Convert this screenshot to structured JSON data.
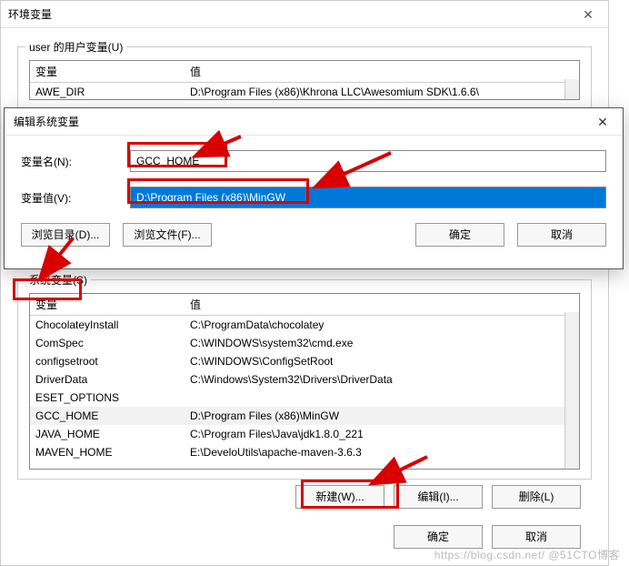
{
  "env": {
    "title": "环境变量",
    "user_group_label": "user 的用户变量(U)",
    "sys_group_label": "系统变量(S)",
    "headers": {
      "name": "变量",
      "value": "值"
    },
    "user_vars": [
      {
        "name": "AWE_DIR",
        "value": "D:\\Program Files (x86)\\Khrona LLC\\Awesomium SDK\\1.6.6\\"
      }
    ],
    "sys_vars": [
      {
        "name": "ChocolateyInstall",
        "value": "C:\\ProgramData\\chocolatey"
      },
      {
        "name": "ComSpec",
        "value": "C:\\WINDOWS\\system32\\cmd.exe"
      },
      {
        "name": "configsetroot",
        "value": "C:\\WINDOWS\\ConfigSetRoot"
      },
      {
        "name": "DriverData",
        "value": "C:\\Windows\\System32\\Drivers\\DriverData"
      },
      {
        "name": "ESET_OPTIONS",
        "value": ""
      },
      {
        "name": "GCC_HOME",
        "value": "D:\\Program Files (x86)\\MinGW",
        "highlight": true
      },
      {
        "name": "JAVA_HOME",
        "value": "C:\\Program Files\\Java\\jdk1.8.0_221"
      },
      {
        "name": "MAVEN_HOME",
        "value": "E:\\DeveloUtils\\apache-maven-3.6.3"
      }
    ],
    "buttons": {
      "new": "新建(W)...",
      "edit": "编辑(I)...",
      "delete": "删除(L)",
      "ok": "确定",
      "cancel": "取消"
    }
  },
  "edit": {
    "title": "编辑系统变量",
    "name_label": "变量名(N):",
    "value_label": "变量值(V):",
    "name_value": "GCC_HOME",
    "value_value": "D:\\Program Files (x86)\\MinGW",
    "browse_dir": "浏览目录(D)...",
    "browse_file": "浏览文件(F)...",
    "ok": "确定",
    "cancel": "取消"
  },
  "watermark": "https://blog.csdn.net/   @51CTO博客"
}
